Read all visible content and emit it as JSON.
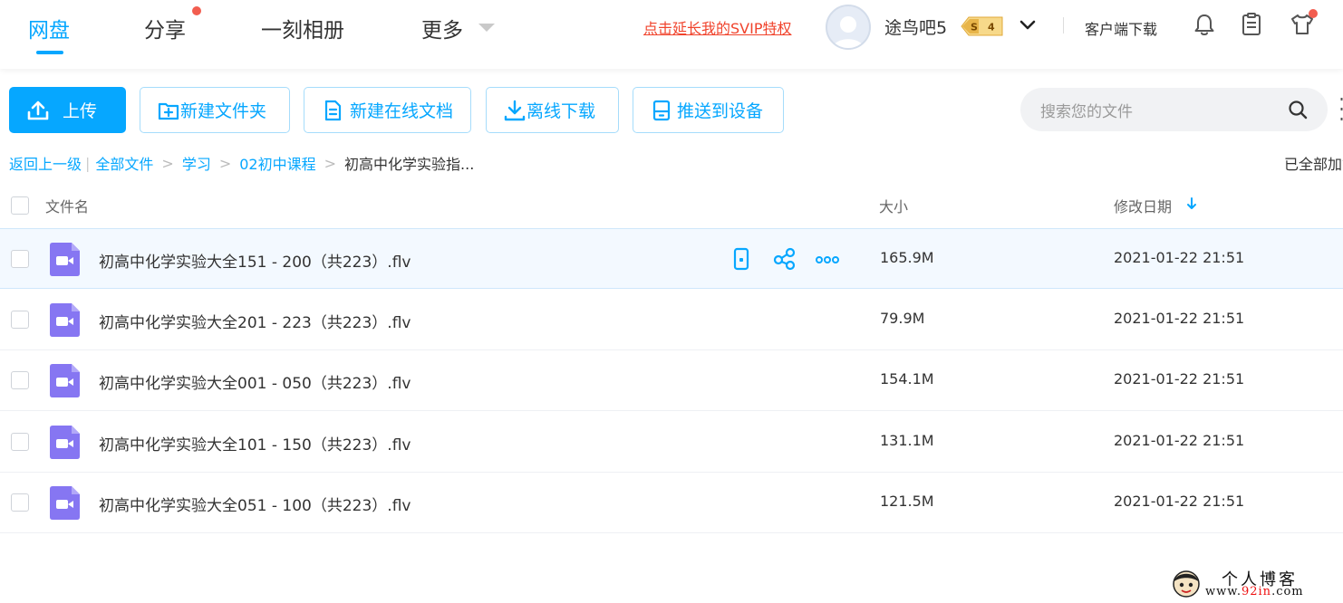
{
  "nav": {
    "tabs": [
      {
        "label": "网盘",
        "active": true
      },
      {
        "label": "分享",
        "badge": true
      },
      {
        "label": "一刻相册"
      },
      {
        "label": "更多"
      }
    ]
  },
  "header": {
    "svip_link": "点击延长我的SVIP特权",
    "username": "途鸟吧5",
    "vip_badge": {
      "letter": "S",
      "level": "4"
    },
    "client_download": "客户端下载",
    "icons": [
      "bell-icon",
      "clipboard-icon",
      "shirt-icon"
    ]
  },
  "toolbar": {
    "upload": "上传",
    "new_folder": "新建文件夹",
    "new_doc": "新建在线文档",
    "offline_download": "离线下载",
    "push_device": "推送到设备"
  },
  "search": {
    "placeholder": "搜索您的文件"
  },
  "breadcrumb": {
    "back": "返回上一级",
    "items": [
      "全部文件",
      "学习",
      "02初中课程"
    ],
    "current": "初高中化学实验指..."
  },
  "status": {
    "loaded": "已全部加载"
  },
  "table": {
    "headers": {
      "name": "文件名",
      "size": "大小",
      "modified": "修改日期"
    },
    "rows": [
      {
        "name": "初高中化学实验大全151 - 200（共223）.flv",
        "size": "165.9M",
        "date": "2021-01-22 21:51"
      },
      {
        "name": "初高中化学实验大全201 - 223（共223）.flv",
        "size": "79.9M",
        "date": "2021-01-22 21:51"
      },
      {
        "name": "初高中化学实验大全001 - 050（共223）.flv",
        "size": "154.1M",
        "date": "2021-01-22 21:51"
      },
      {
        "name": "初高中化学实验大全101 - 150（共223）.flv",
        "size": "131.1M",
        "date": "2021-01-22 21:51"
      },
      {
        "name": "初高中化学实验大全051 - 100（共223）.flv",
        "size": "121.5M",
        "date": "2021-01-22 21:51"
      }
    ]
  },
  "watermark": {
    "line1": "个人博客",
    "line2_prefix": "www.",
    "line2_highlight": "92in",
    "line2_suffix": ".com"
  },
  "colors": {
    "accent": "#06a7ff",
    "video_icon": "#8676f2",
    "link_red": "#f0432c",
    "badge_gold": "#e8b54a"
  }
}
